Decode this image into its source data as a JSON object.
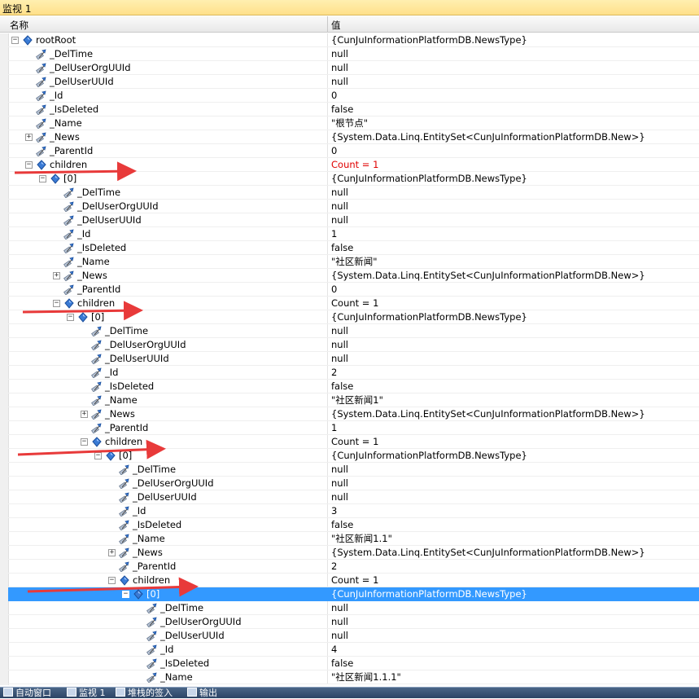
{
  "window": {
    "title": "监视 1"
  },
  "columns": {
    "name": "名称",
    "value": "值"
  },
  "rows": [
    {
      "label": "rootRoot",
      "value": "{CunJuInformationPlatformDB.NewsType}",
      "depth": 0,
      "expander": "minus",
      "icon": "object-icon"
    },
    {
      "label": "_DelTime",
      "value": "null",
      "depth": 1,
      "icon": "property-icon"
    },
    {
      "label": "_DelUserOrgUUId",
      "value": "null",
      "depth": 1,
      "icon": "property-icon"
    },
    {
      "label": "_DelUserUUId",
      "value": "null",
      "depth": 1,
      "icon": "property-icon"
    },
    {
      "label": "_Id",
      "value": "0",
      "depth": 1,
      "icon": "property-icon"
    },
    {
      "label": "_IsDeleted",
      "value": "false",
      "depth": 1,
      "icon": "property-icon"
    },
    {
      "label": "_Name",
      "value": "\"根节点\"",
      "depth": 1,
      "icon": "property-icon"
    },
    {
      "label": "_News",
      "value": "{System.Data.Linq.EntitySet<CunJuInformationPlatformDB.New>}",
      "depth": 1,
      "expander": "plus",
      "icon": "property-icon"
    },
    {
      "label": "_ParentId",
      "value": "0",
      "depth": 1,
      "icon": "property-icon"
    },
    {
      "label": "children",
      "value": "Count = 1",
      "depth": 1,
      "expander": "minus",
      "icon": "object-icon",
      "value_red": true
    },
    {
      "label": "[0]",
      "value": "{CunJuInformationPlatformDB.NewsType}",
      "depth": 2,
      "expander": "minus",
      "icon": "object-icon"
    },
    {
      "label": "_DelTime",
      "value": "null",
      "depth": 3,
      "icon": "property-icon"
    },
    {
      "label": "_DelUserOrgUUId",
      "value": "null",
      "depth": 3,
      "icon": "property-icon"
    },
    {
      "label": "_DelUserUUId",
      "value": "null",
      "depth": 3,
      "icon": "property-icon"
    },
    {
      "label": "_Id",
      "value": "1",
      "depth": 3,
      "icon": "property-icon"
    },
    {
      "label": "_IsDeleted",
      "value": "false",
      "depth": 3,
      "icon": "property-icon"
    },
    {
      "label": "_Name",
      "value": "\"社区新闻\"",
      "depth": 3,
      "icon": "property-icon"
    },
    {
      "label": "_News",
      "value": "{System.Data.Linq.EntitySet<CunJuInformationPlatformDB.New>}",
      "depth": 3,
      "expander": "plus",
      "icon": "property-icon"
    },
    {
      "label": "_ParentId",
      "value": "0",
      "depth": 3,
      "icon": "property-icon"
    },
    {
      "label": "children",
      "value": "Count = 1",
      "depth": 3,
      "expander": "minus",
      "icon": "object-icon"
    },
    {
      "label": "[0]",
      "value": "{CunJuInformationPlatformDB.NewsType}",
      "depth": 4,
      "expander": "minus",
      "icon": "object-icon"
    },
    {
      "label": "_DelTime",
      "value": "null",
      "depth": 5,
      "icon": "property-icon"
    },
    {
      "label": "_DelUserOrgUUId",
      "value": "null",
      "depth": 5,
      "icon": "property-icon"
    },
    {
      "label": "_DelUserUUId",
      "value": "null",
      "depth": 5,
      "icon": "property-icon"
    },
    {
      "label": "_Id",
      "value": "2",
      "depth": 5,
      "icon": "property-icon"
    },
    {
      "label": "_IsDeleted",
      "value": "false",
      "depth": 5,
      "icon": "property-icon"
    },
    {
      "label": "_Name",
      "value": "\"社区新闻1\"",
      "depth": 5,
      "icon": "property-icon"
    },
    {
      "label": "_News",
      "value": "{System.Data.Linq.EntitySet<CunJuInformationPlatformDB.New>}",
      "depth": 5,
      "expander": "plus",
      "icon": "property-icon"
    },
    {
      "label": "_ParentId",
      "value": "1",
      "depth": 5,
      "icon": "property-icon"
    },
    {
      "label": "children",
      "value": "Count = 1",
      "depth": 5,
      "expander": "minus",
      "icon": "object-icon"
    },
    {
      "label": "[0]",
      "value": "{CunJuInformationPlatformDB.NewsType}",
      "depth": 6,
      "expander": "minus",
      "icon": "object-icon"
    },
    {
      "label": "_DelTime",
      "value": "null",
      "depth": 7,
      "icon": "property-icon"
    },
    {
      "label": "_DelUserOrgUUId",
      "value": "null",
      "depth": 7,
      "icon": "property-icon"
    },
    {
      "label": "_DelUserUUId",
      "value": "null",
      "depth": 7,
      "icon": "property-icon"
    },
    {
      "label": "_Id",
      "value": "3",
      "depth": 7,
      "icon": "property-icon"
    },
    {
      "label": "_IsDeleted",
      "value": "false",
      "depth": 7,
      "icon": "property-icon"
    },
    {
      "label": "_Name",
      "value": "\"社区新闻1.1\"",
      "depth": 7,
      "icon": "property-icon"
    },
    {
      "label": "_News",
      "value": "{System.Data.Linq.EntitySet<CunJuInformationPlatformDB.New>}",
      "depth": 7,
      "expander": "plus",
      "icon": "property-icon"
    },
    {
      "label": "_ParentId",
      "value": "2",
      "depth": 7,
      "icon": "property-icon"
    },
    {
      "label": "children",
      "value": "Count = 1",
      "depth": 7,
      "expander": "minus",
      "icon": "object-icon"
    },
    {
      "label": "[0]",
      "value": "{CunJuInformationPlatformDB.NewsType}",
      "depth": 8,
      "expander": "minus",
      "icon": "object-icon",
      "selected": true
    },
    {
      "label": "_DelTime",
      "value": "null",
      "depth": 9,
      "icon": "property-icon"
    },
    {
      "label": "_DelUserOrgUUId",
      "value": "null",
      "depth": 9,
      "icon": "property-icon"
    },
    {
      "label": "_DelUserUUId",
      "value": "null",
      "depth": 9,
      "icon": "property-icon"
    },
    {
      "label": "_Id",
      "value": "4",
      "depth": 9,
      "icon": "property-icon"
    },
    {
      "label": "_IsDeleted",
      "value": "false",
      "depth": 9,
      "icon": "property-icon"
    },
    {
      "label": "_Name",
      "value": "\"社区新闻1.1.1\"",
      "depth": 9,
      "icon": "property-icon"
    }
  ],
  "colors": {
    "selection": "#3399ff",
    "accent_red": "#e00000",
    "arrow": "#e83a3a"
  },
  "statusbar": {
    "tabs": [
      "自动窗口",
      "监视 1",
      "堆栈的签入",
      "输出"
    ]
  }
}
